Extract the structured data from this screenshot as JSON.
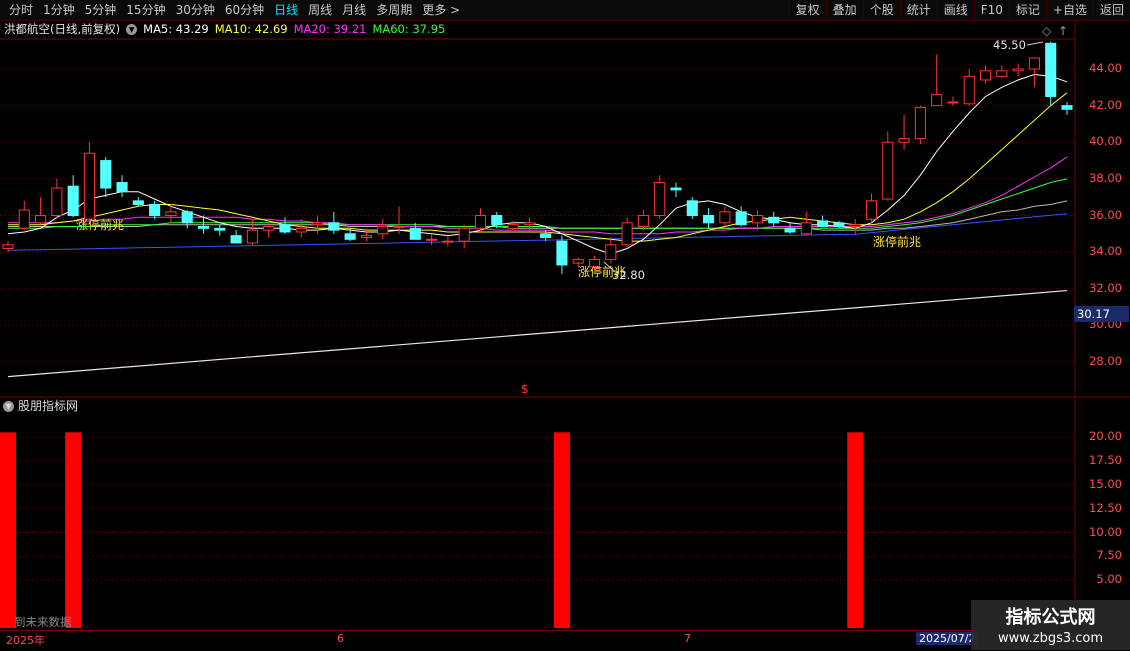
{
  "toolbar": {
    "left": [
      "分时",
      "1分钟",
      "5分钟",
      "15分钟",
      "30分钟",
      "60分钟",
      "日线",
      "周线",
      "月线",
      "多周期",
      "更多 >"
    ],
    "active": "日线",
    "right": [
      "复权",
      "叠加",
      "个股",
      "统计",
      "画线",
      "F10",
      "标记",
      "+自选",
      "返回"
    ]
  },
  "stock": {
    "title": "洪都航空(日线,前复权)",
    "ma5": "MA5: 43.29",
    "ma10": "MA10: 42.69",
    "ma20": "MA20: 39.21",
    "ma60": "MA60: 37.95"
  },
  "colors": {
    "ma5": "#ffffff",
    "ma10": "#ffff33",
    "ma20": "#ff33ff",
    "ma60": "#33ff33",
    "up": "#ff3333",
    "down": "#54ffff",
    "bar": "#ff0000"
  },
  "price_axis": [
    "44.00",
    "42.00",
    "40.00",
    "38.00",
    "36.00",
    "34.00",
    "32.00",
    "30.00",
    "28.00"
  ],
  "current_price": "30.17",
  "indicator": {
    "title": "股朋指标网",
    "axis": [
      "20.00",
      "17.50",
      "15.00",
      "12.50",
      "10.00",
      "7.50",
      "5.00"
    ]
  },
  "annotations": {
    "limit_up": "涨停前兆",
    "peak": "45.50",
    "low": "32.80",
    "dollar": "$"
  },
  "date_axis": {
    "start": "2025年",
    "m6": "6",
    "m7": "7",
    "selected": "2025/07/2"
  },
  "ghost_text": "到未来数据",
  "watermark": {
    "line1": "指标公式网",
    "line2": "www.zbgs3.com"
  },
  "chart_data": {
    "type": "candlestick",
    "ylim": [
      26.8,
      45.5
    ],
    "candles": [
      {
        "o": 34.2,
        "h": 34.6,
        "l": 34.0,
        "c": 34.4
      },
      {
        "o": 35.3,
        "h": 36.8,
        "l": 35.2,
        "c": 36.3
      },
      {
        "o": 35.6,
        "h": 37.0,
        "l": 35.5,
        "c": 36.0
      },
      {
        "o": 36.0,
        "h": 38.0,
        "l": 35.8,
        "c": 37.5
      },
      {
        "o": 37.6,
        "h": 38.2,
        "l": 35.9,
        "c": 36.0
      },
      {
        "o": 35.8,
        "h": 40.0,
        "l": 35.6,
        "c": 39.4
      },
      {
        "o": 39.0,
        "h": 39.2,
        "l": 37.0,
        "c": 37.5
      },
      {
        "o": 37.8,
        "h": 38.2,
        "l": 37.0,
        "c": 37.3
      },
      {
        "o": 36.8,
        "h": 37.0,
        "l": 36.5,
        "c": 36.6
      },
      {
        "o": 36.6,
        "h": 36.8,
        "l": 35.8,
        "c": 36.0
      },
      {
        "o": 36.0,
        "h": 36.6,
        "l": 35.6,
        "c": 36.2
      },
      {
        "o": 36.2,
        "h": 36.3,
        "l": 35.3,
        "c": 35.6
      },
      {
        "o": 35.4,
        "h": 36.0,
        "l": 35.0,
        "c": 35.3
      },
      {
        "o": 35.3,
        "h": 35.5,
        "l": 34.9,
        "c": 35.2
      },
      {
        "o": 34.9,
        "h": 35.2,
        "l": 34.5,
        "c": 34.5
      },
      {
        "o": 34.5,
        "h": 35.8,
        "l": 34.4,
        "c": 35.2
      },
      {
        "o": 35.2,
        "h": 35.6,
        "l": 34.8,
        "c": 35.4
      },
      {
        "o": 35.5,
        "h": 35.9,
        "l": 35.0,
        "c": 35.1
      },
      {
        "o": 35.1,
        "h": 35.8,
        "l": 34.8,
        "c": 35.3
      },
      {
        "o": 35.5,
        "h": 36.0,
        "l": 35.0,
        "c": 35.6
      },
      {
        "o": 35.6,
        "h": 36.2,
        "l": 35.0,
        "c": 35.2
      },
      {
        "o": 35.0,
        "h": 35.3,
        "l": 34.6,
        "c": 34.7
      },
      {
        "o": 34.8,
        "h": 35.3,
        "l": 34.6,
        "c": 34.9
      },
      {
        "o": 35.0,
        "h": 35.8,
        "l": 34.7,
        "c": 35.4
      },
      {
        "o": 35.4,
        "h": 36.5,
        "l": 35.0,
        "c": 35.4
      },
      {
        "o": 35.3,
        "h": 35.6,
        "l": 34.7,
        "c": 34.7
      },
      {
        "o": 34.7,
        "h": 35.0,
        "l": 34.4,
        "c": 34.7
      },
      {
        "o": 34.6,
        "h": 34.9,
        "l": 34.3,
        "c": 34.6
      },
      {
        "o": 34.6,
        "h": 35.5,
        "l": 34.2,
        "c": 35.3
      },
      {
        "o": 35.3,
        "h": 36.4,
        "l": 35.1,
        "c": 36.0
      },
      {
        "o": 36.0,
        "h": 36.2,
        "l": 35.3,
        "c": 35.5
      },
      {
        "o": 35.3,
        "h": 35.7,
        "l": 35.2,
        "c": 35.5
      },
      {
        "o": 35.5,
        "h": 35.9,
        "l": 35.1,
        "c": 35.6
      },
      {
        "o": 35.0,
        "h": 35.2,
        "l": 34.6,
        "c": 34.8
      },
      {
        "o": 34.6,
        "h": 34.9,
        "l": 32.8,
        "c": 33.3
      },
      {
        "o": 33.4,
        "h": 33.7,
        "l": 33.2,
        "c": 33.6
      },
      {
        "o": 33.2,
        "h": 33.8,
        "l": 33.0,
        "c": 33.6
      },
      {
        "o": 33.6,
        "h": 34.8,
        "l": 33.4,
        "c": 34.4
      },
      {
        "o": 34.4,
        "h": 35.9,
        "l": 34.3,
        "c": 35.6
      },
      {
        "o": 35.4,
        "h": 36.3,
        "l": 35.2,
        "c": 36.0
      },
      {
        "o": 36.0,
        "h": 38.2,
        "l": 35.8,
        "c": 37.8
      },
      {
        "o": 37.5,
        "h": 37.8,
        "l": 37.0,
        "c": 37.4
      },
      {
        "o": 36.8,
        "h": 37.0,
        "l": 35.8,
        "c": 36.0
      },
      {
        "o": 36.0,
        "h": 36.4,
        "l": 35.3,
        "c": 35.6
      },
      {
        "o": 35.6,
        "h": 36.5,
        "l": 35.4,
        "c": 36.2
      },
      {
        "o": 36.2,
        "h": 36.5,
        "l": 35.4,
        "c": 35.5
      },
      {
        "o": 35.6,
        "h": 36.3,
        "l": 35.2,
        "c": 36.0
      },
      {
        "o": 35.9,
        "h": 36.2,
        "l": 35.4,
        "c": 35.6
      },
      {
        "o": 35.3,
        "h": 35.6,
        "l": 35.0,
        "c": 35.1
      },
      {
        "o": 35.0,
        "h": 36.2,
        "l": 34.9,
        "c": 35.6
      },
      {
        "o": 35.7,
        "h": 36.0,
        "l": 35.4,
        "c": 35.4
      },
      {
        "o": 35.6,
        "h": 35.7,
        "l": 35.3,
        "c": 35.4
      },
      {
        "o": 35.4,
        "h": 35.8,
        "l": 35.0,
        "c": 35.5
      },
      {
        "o": 35.8,
        "h": 37.2,
        "l": 35.6,
        "c": 36.8
      },
      {
        "o": 36.9,
        "h": 40.6,
        "l": 36.8,
        "c": 40.0
      },
      {
        "o": 40.0,
        "h": 41.5,
        "l": 39.6,
        "c": 40.2
      },
      {
        "o": 40.2,
        "h": 42.0,
        "l": 39.9,
        "c": 41.9
      },
      {
        "o": 42.0,
        "h": 44.8,
        "l": 42.0,
        "c": 42.6
      },
      {
        "o": 42.2,
        "h": 42.5,
        "l": 42.0,
        "c": 42.2
      },
      {
        "o": 42.1,
        "h": 44.0,
        "l": 42.0,
        "c": 43.6
      },
      {
        "o": 43.4,
        "h": 44.2,
        "l": 43.2,
        "c": 43.9
      },
      {
        "o": 43.6,
        "h": 44.2,
        "l": 43.5,
        "c": 43.9
      },
      {
        "o": 43.9,
        "h": 44.3,
        "l": 43.6,
        "c": 44.0
      },
      {
        "o": 44.0,
        "h": 44.6,
        "l": 43.0,
        "c": 44.6
      },
      {
        "o": 45.4,
        "h": 45.5,
        "l": 42.0,
        "c": 42.5
      },
      {
        "o": 42.0,
        "h": 42.2,
        "l": 41.5,
        "c": 41.8
      }
    ],
    "ma5": [
      35.0,
      35.1,
      35.3,
      35.9,
      36.3,
      36.9,
      37.1,
      37.3,
      37.3,
      36.9,
      36.5,
      36.2,
      35.9,
      35.6,
      35.4,
      35.3,
      35.3,
      35.3,
      35.2,
      35.2,
      35.3,
      35.2,
      35.1,
      35.1,
      35.2,
      35.1,
      35.0,
      34.9,
      35.0,
      35.2,
      35.5,
      35.6,
      35.6,
      35.4,
      35.0,
      34.6,
      34.2,
      33.9,
      34.2,
      34.7,
      35.5,
      36.4,
      36.7,
      36.8,
      36.6,
      36.2,
      35.9,
      35.8,
      35.6,
      35.5,
      35.5,
      35.4,
      35.3,
      35.6,
      36.3,
      37.1,
      38.2,
      39.5,
      40.6,
      41.6,
      42.5,
      43.0,
      43.4,
      43.7,
      43.6,
      43.3
    ],
    "ma10": [
      35.5,
      35.5,
      35.5,
      35.6,
      35.7,
      35.9,
      36.1,
      36.3,
      36.5,
      36.6,
      36.6,
      36.5,
      36.4,
      36.3,
      36.1,
      35.9,
      35.7,
      35.5,
      35.4,
      35.3,
      35.3,
      35.3,
      35.2,
      35.2,
      35.2,
      35.2,
      35.2,
      35.1,
      35.1,
      35.1,
      35.1,
      35.1,
      35.1,
      35.1,
      35.0,
      34.9,
      34.8,
      34.7,
      34.6,
      34.6,
      34.7,
      34.8,
      35.0,
      35.2,
      35.4,
      35.6,
      35.7,
      35.8,
      35.9,
      35.8,
      35.7,
      35.6,
      35.5,
      35.5,
      35.6,
      35.8,
      36.2,
      36.7,
      37.3,
      38.0,
      38.8,
      39.6,
      40.4,
      41.2,
      42.0,
      42.7
    ],
    "ma20": [
      35.6,
      35.6,
      35.6,
      35.6,
      35.7,
      35.7,
      35.8,
      35.8,
      35.9,
      35.9,
      35.9,
      35.9,
      35.9,
      35.9,
      35.9,
      35.8,
      35.8,
      35.7,
      35.7,
      35.6,
      35.6,
      35.5,
      35.5,
      35.5,
      35.4,
      35.4,
      35.4,
      35.3,
      35.3,
      35.3,
      35.2,
      35.2,
      35.2,
      35.2,
      35.1,
      35.1,
      35.1,
      35.0,
      35.0,
      35.0,
      35.0,
      35.1,
      35.1,
      35.2,
      35.2,
      35.3,
      35.3,
      35.4,
      35.4,
      35.4,
      35.4,
      35.4,
      35.4,
      35.4,
      35.5,
      35.6,
      35.7,
      35.9,
      36.1,
      36.4,
      36.7,
      37.1,
      37.6,
      38.1,
      38.6,
      39.2
    ],
    "ma60": [
      35.3,
      35.3,
      35.3,
      35.4,
      35.4,
      35.4,
      35.5,
      35.5,
      35.5,
      35.5,
      35.6,
      35.6,
      35.6,
      35.6,
      35.6,
      35.6,
      35.6,
      35.6,
      35.6,
      35.6,
      35.5,
      35.5,
      35.5,
      35.5,
      35.5,
      35.5,
      35.5,
      35.4,
      35.4,
      35.4,
      35.4,
      35.4,
      35.4,
      35.4,
      35.3,
      35.3,
      35.3,
      35.3,
      35.3,
      35.3,
      35.3,
      35.3,
      35.3,
      35.3,
      35.3,
      35.3,
      35.3,
      35.3,
      35.3,
      35.3,
      35.3,
      35.3,
      35.3,
      35.3,
      35.4,
      35.5,
      35.6,
      35.8,
      36.0,
      36.3,
      36.6,
      36.9,
      37.2,
      37.5,
      37.8,
      38.0
    ],
    "ma_grey": [
      35.4,
      35.4,
      35.4,
      35.4,
      35.4,
      35.4,
      35.4,
      35.4,
      35.4,
      35.5,
      35.5,
      35.5,
      35.5,
      35.5,
      35.5,
      35.5,
      35.5,
      35.5,
      35.5,
      35.5,
      35.5,
      35.4,
      35.4,
      35.4,
      35.4,
      35.4,
      35.4,
      35.4,
      35.4,
      35.4,
      35.4,
      35.3,
      35.3,
      35.3,
      35.3,
      35.3,
      35.3,
      35.3,
      35.3,
      35.3,
      35.3,
      35.3,
      35.3,
      35.3,
      35.3,
      35.3,
      35.3,
      35.3,
      35.3,
      35.3,
      35.2,
      35.2,
      35.2,
      35.2,
      35.3,
      35.3,
      35.4,
      35.5,
      35.6,
      35.8,
      36.0,
      36.2,
      36.3,
      36.5,
      36.6,
      36.8
    ],
    "ma_blue_range": [
      34.1,
      36.1
    ],
    "long_line_range": [
      27.2,
      31.9
    ],
    "signal_bars": [
      0,
      4,
      34,
      52
    ],
    "signal_value": 20.5,
    "indicator_ylim": [
      0,
      22
    ]
  }
}
